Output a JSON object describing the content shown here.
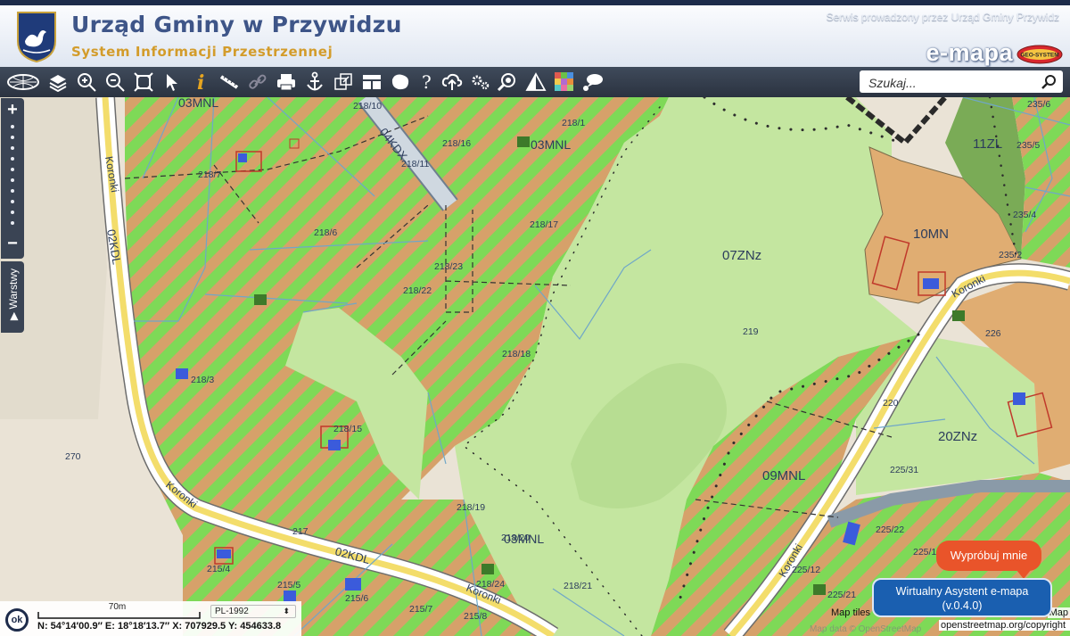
{
  "header": {
    "title": "Urząd Gminy w Przywidzu",
    "subtitle": "System Informacji Przestrzennej",
    "operator_note": "Serwis prowadzony przez Urząd Gminy Przywidz",
    "brand": "e-mapa",
    "badge_text": "GEO-SYSTEM"
  },
  "toolbar": {
    "tools": [
      "logo-icon",
      "layers-icon",
      "zoom-in-icon",
      "zoom-out-icon",
      "full-extent-icon",
      "select-pointer-icon",
      "info-icon",
      "measure-ruler-icon",
      "link-icon",
      "print-icon",
      "anchor-icon",
      "export-icon",
      "layout-icon",
      "shape-icon",
      "help-icon",
      "cloud-upload-icon",
      "settings-icon",
      "zoom-search-icon",
      "warning-icon",
      "color-palette-icon",
      "comment-icon"
    ],
    "search_placeholder": "Szukaj..."
  },
  "map": {
    "zone_labels": [
      "03MNL",
      "03MNL",
      "07ZNz",
      "10MN",
      "11ZL",
      "20ZNz",
      "09MNL",
      "03MNL",
      "02KDL",
      "02KDL",
      "04KDX"
    ],
    "parcel_labels": [
      "218/10",
      "218/1",
      "218/16",
      "218/11",
      "218/7",
      "218/6",
      "218/17",
      "218/23",
      "218/22",
      "218/18",
      "218/3",
      "218/15",
      "270",
      "219",
      "226",
      "220",
      "225/31",
      "218/19",
      "218/20",
      "218/24",
      "218/21",
      "217",
      "215/4",
      "215/5",
      "215/6",
      "215/7",
      "215/8",
      "225/22",
      "225/1",
      "225/12",
      "225/21",
      "235/6",
      "235/5",
      "235/4",
      "235/2"
    ],
    "street_labels": [
      "Koronki",
      "Koronki",
      "Koronki",
      "Koronki",
      "Koronki"
    ],
    "colors": {
      "stripe_green": "#7ed957",
      "stripe_orange": "#d6a16a",
      "light_green": "#c4e6a0",
      "mn_orange": "#e0ad72",
      "forest": "#7aab56",
      "road_yellow": "#f3dd6b"
    }
  },
  "controls": {
    "zoom_in": "+",
    "zoom_out": "−",
    "layers_tab": "Warstwy"
  },
  "status": {
    "ok_label": "ok",
    "scale_label": "70m",
    "crs": "PL-1992",
    "coords": "N: 54°14′00.9″  E: 18°18′13.7″  X: 707929.5  Y: 454633.8"
  },
  "assistant": {
    "try_label": "Wypróbuj mnie",
    "title": "Wirtualny Asystent e-mapa",
    "version": "(v.0.4.0)"
  },
  "attribution": {
    "map_tiles": "Map tiles",
    "map_data": "Map data © OpenStreetMap",
    "map": "Map",
    "link": "openstreetmap.org/copyright"
  }
}
